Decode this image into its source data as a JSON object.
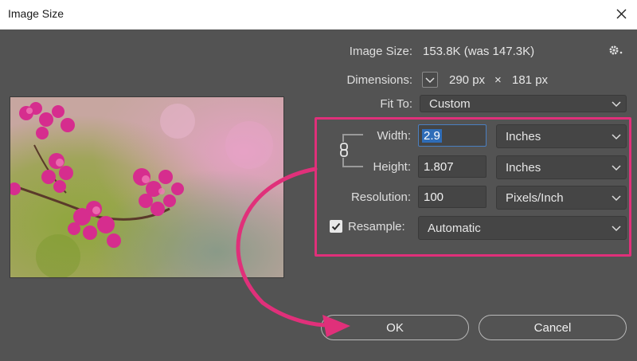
{
  "window": {
    "title": "Image Size"
  },
  "info": {
    "image_size_label": "Image Size:",
    "image_size_value": "153.8K (was 147.3K)",
    "dimensions_label": "Dimensions:",
    "dimensions_width": "290 px",
    "dimensions_times": "×",
    "dimensions_height": "181 px"
  },
  "fit_to": {
    "label": "Fit To:",
    "value": "Custom"
  },
  "width": {
    "label": "Width:",
    "value": "2.9",
    "unit": "Inches"
  },
  "height": {
    "label": "Height:",
    "value": "1.807",
    "unit": "Inches"
  },
  "resolution": {
    "label": "Resolution:",
    "value": "100",
    "unit": "Pixels/Inch"
  },
  "resample": {
    "label": "Resample:",
    "checked": true,
    "value": "Automatic"
  },
  "buttons": {
    "ok": "OK",
    "cancel": "Cancel"
  },
  "colors": {
    "highlight": "#e0307a",
    "dialog_bg": "#535353"
  },
  "icons": [
    "close-icon",
    "gear-icon",
    "chevron-down-icon",
    "link-icon",
    "checkbox-icon",
    "flower-preview-image"
  ]
}
